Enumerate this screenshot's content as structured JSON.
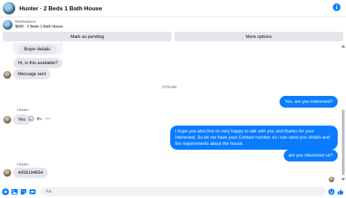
{
  "header": {
    "title": "Hunter · 2 Beds 1 Bath House",
    "info_icon": "info-icon"
  },
  "market": {
    "label": "Marketplace",
    "item": "$600 · 2 Beds 1 Bath House"
  },
  "actions": {
    "pending": "Mark as pending",
    "more": "More options"
  },
  "messages": {
    "card_title": "Buyer details",
    "incoming_1": "Hi, is this available?",
    "incoming_2": "Message sent",
    "time": "10:50 AM",
    "outgoing_1": "Yes, are you interested?",
    "sender_1": "Hunter",
    "incoming_3": "Yes",
    "outgoing_2": "I hope you also fine im very happy to talk with you and thanks for your interested. So let me have your Contact number so i can send you details and the requirements about the house.",
    "outgoing_3": "are you interested sir?",
    "sender_2": "Hunter",
    "incoming_4": "4058194654"
  },
  "composer": {
    "placeholder": "Aa"
  },
  "colors": {
    "accent": "#0a7cff",
    "bubble_in": "#e4e6eb"
  }
}
